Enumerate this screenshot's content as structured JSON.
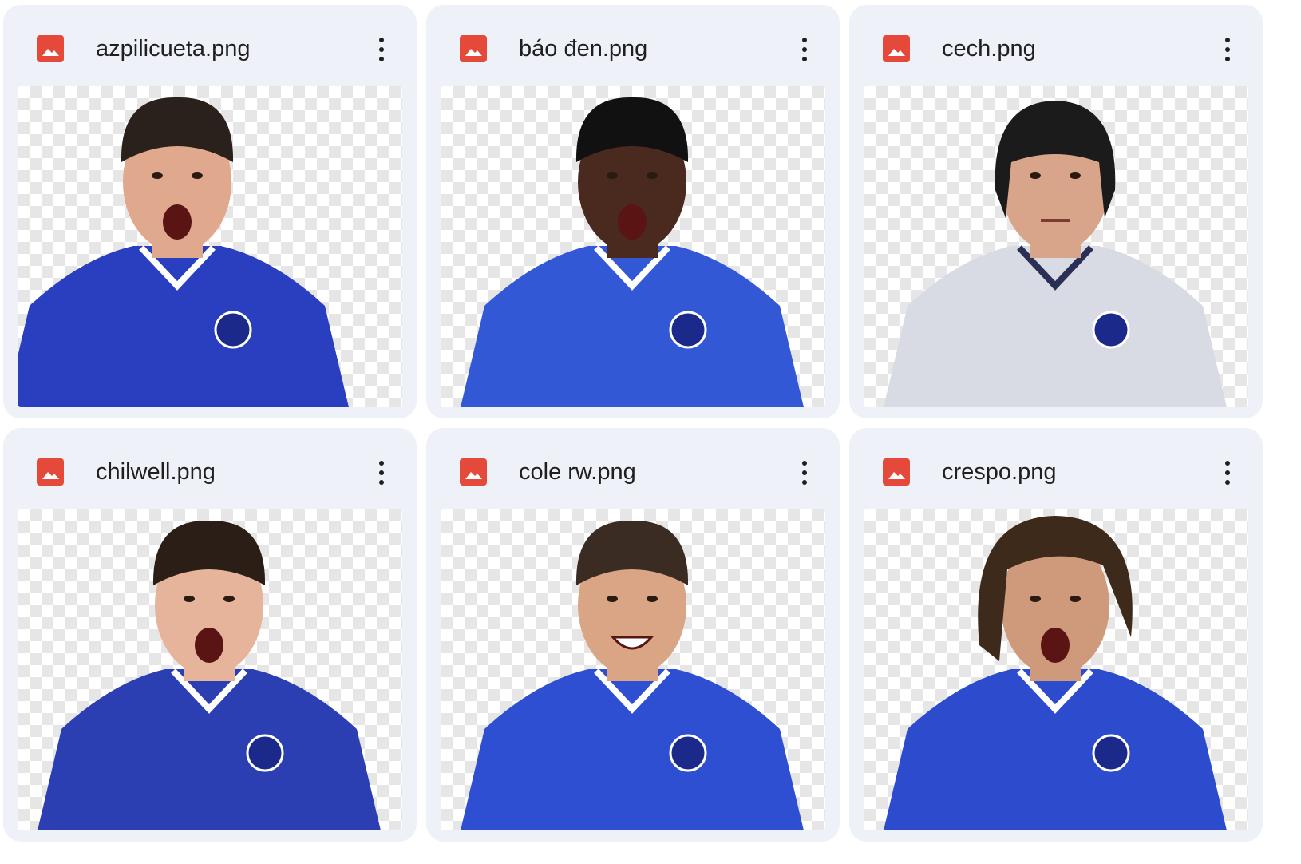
{
  "files": [
    {
      "name": "azpilicueta.png",
      "icon": "image-file-icon",
      "kit_color": "#2a3fbf",
      "hair_color": "#2a211c",
      "skin_color": "#e0a88c",
      "mouth": "open"
    },
    {
      "name": "báo đen.png",
      "icon": "image-file-icon",
      "kit_color": "#3358d6",
      "hair_color": "#111111",
      "skin_color": "#4a2a1f",
      "mouth": "open"
    },
    {
      "name": "cech.png",
      "icon": "image-file-icon",
      "kit_color": "#d9dbe4",
      "hair_color": "#1b1b1b",
      "skin_color": "#d9a58a",
      "mouth": "closed"
    },
    {
      "name": "chilwell.png",
      "icon": "image-file-icon",
      "kit_color": "#2b3fb3",
      "hair_color": "#2b1e17",
      "skin_color": "#e6b49b",
      "mouth": "open"
    },
    {
      "name": "cole rw.png",
      "icon": "image-file-icon",
      "kit_color": "#2e4fd1",
      "hair_color": "#3a2c22",
      "skin_color": "#d9a584",
      "mouth": "smile"
    },
    {
      "name": "crespo.png",
      "icon": "image-file-icon",
      "kit_color": "#2c4ccd",
      "hair_color": "#3d2a1a",
      "skin_color": "#cf9a7c",
      "mouth": "open"
    }
  ],
  "colors": {
    "card_bg": "#eef1f7",
    "file_icon_bg": "#e5493a",
    "text": "#1f1f1f"
  }
}
